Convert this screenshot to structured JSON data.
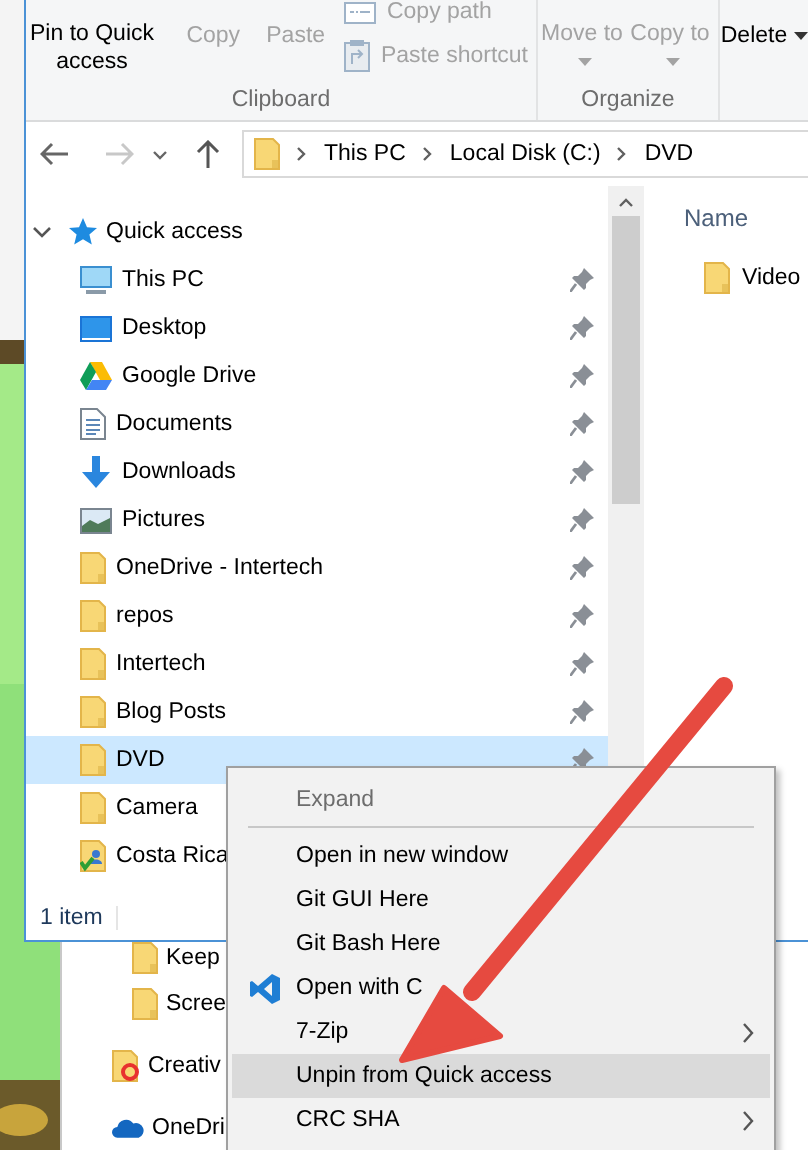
{
  "ribbon": {
    "groups": [
      {
        "label": "Clipboard",
        "buttons": [
          {
            "kind": "large",
            "label": "Pin to Quick access",
            "disabled": false
          },
          {
            "kind": "large",
            "label": "Copy",
            "disabled": true
          },
          {
            "kind": "large",
            "label": "Paste",
            "disabled": true
          },
          {
            "kind": "small",
            "label": "Copy path",
            "disabled": true
          },
          {
            "kind": "small",
            "label": "Paste shortcut",
            "disabled": true
          }
        ]
      },
      {
        "label": "Organize",
        "buttons": [
          {
            "kind": "split",
            "label": "Move to",
            "disabled": true
          },
          {
            "kind": "split",
            "label": "Copy to",
            "disabled": true
          }
        ]
      },
      {
        "buttons": [
          {
            "kind": "split",
            "label": "Delete",
            "disabled": false
          }
        ]
      }
    ]
  },
  "address": {
    "back_disabled": false,
    "forward_disabled": true,
    "crumbs": [
      "This PC",
      "Local Disk (C:)",
      "DVD"
    ]
  },
  "navigation": {
    "label": "Quick access",
    "expanded": true,
    "children": [
      {
        "label": "This PC",
        "kind": "pc",
        "pinned": true,
        "selected": false
      },
      {
        "label": "Desktop",
        "kind": "desktop",
        "pinned": true,
        "selected": false
      },
      {
        "label": "Google Drive",
        "kind": "gdrive",
        "pinned": true,
        "selected": false
      },
      {
        "label": "Documents",
        "kind": "documents",
        "pinned": true,
        "selected": false
      },
      {
        "label": "Downloads",
        "kind": "downloads",
        "pinned": true,
        "selected": false
      },
      {
        "label": "Pictures",
        "kind": "pictures",
        "pinned": true,
        "selected": false
      },
      {
        "label": "OneDrive - Intertech",
        "kind": "folder",
        "pinned": true,
        "selected": false
      },
      {
        "label": "repos",
        "kind": "folder",
        "pinned": true,
        "selected": false
      },
      {
        "label": "Intertech",
        "kind": "folder",
        "pinned": true,
        "selected": false
      },
      {
        "label": "Blog Posts",
        "kind": "folder",
        "pinned": true,
        "selected": false
      },
      {
        "label": "DVD",
        "kind": "folder",
        "pinned": true,
        "selected": true
      },
      {
        "label": "Camera",
        "kind": "folder",
        "pinned": false,
        "selected": false
      },
      {
        "label": "Costa Rica",
        "kind": "synced_folder",
        "pinned": false,
        "selected": false
      }
    ]
  },
  "content": {
    "column": "Name",
    "items": [
      {
        "name": "Video",
        "kind": "folder"
      }
    ]
  },
  "status_bar": {
    "count": "1 item"
  },
  "background_window": {
    "items": [
      {
        "children": [
          {
            "label": "Keep",
            "kind": "folder"
          },
          {
            "label": "Scree",
            "kind": "folder"
          }
        ]
      },
      {
        "label": "Creativ",
        "kind": "creative_cloud"
      },
      {
        "label": "OneDri",
        "kind": "onedrive"
      }
    ]
  },
  "context_menu": {
    "items": [
      {
        "kind": "item",
        "label": "Expand",
        "disabled": true,
        "selected": false
      },
      {
        "kind": "separator"
      },
      {
        "kind": "item",
        "label": "Open in new window",
        "disabled": false,
        "selected": false
      },
      {
        "kind": "item",
        "label": "Git GUI Here",
        "disabled": false,
        "selected": false
      },
      {
        "kind": "item",
        "label": "Git Bash Here",
        "disabled": false,
        "selected": false
      },
      {
        "kind": "app_item",
        "label": "Open with C",
        "disabled": false,
        "selected": false
      },
      {
        "kind": "submenu",
        "label": "7-Zip",
        "disabled": false,
        "selected": false
      },
      {
        "kind": "item",
        "label": "Unpin from Quick access",
        "disabled": false,
        "selected": true
      },
      {
        "kind": "submenu",
        "label": "CRC SHA",
        "disabled": false,
        "selected": false
      }
    ]
  }
}
